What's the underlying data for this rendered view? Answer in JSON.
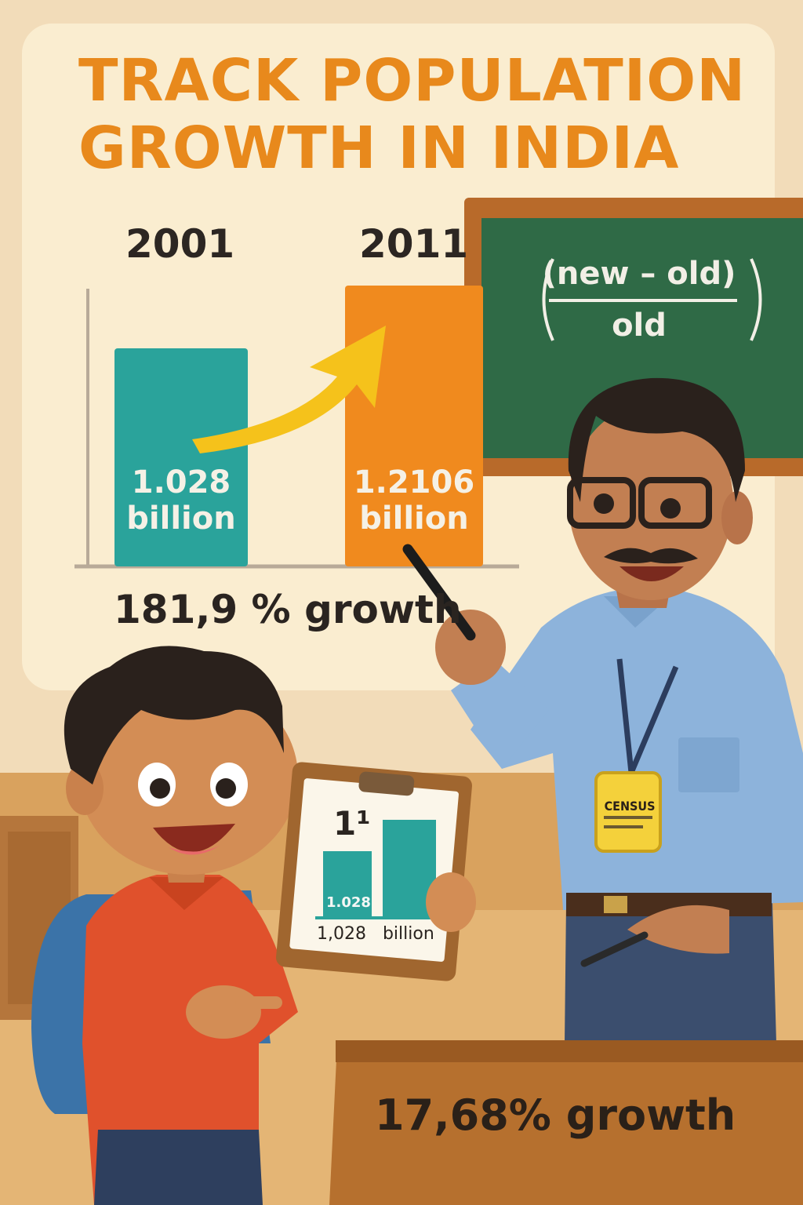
{
  "title": {
    "line1": "TRACK POPULATION",
    "line2": "GROWTH IN INDIA"
  },
  "chart": {
    "bars": [
      {
        "year": "2001",
        "value_line1": "1.028",
        "value_line2": "billion",
        "color": "#2aa39b"
      },
      {
        "year": "2011",
        "value_line1": "1.2106",
        "value_line2": "billion",
        "color": "#f08a1e"
      }
    ],
    "arrow_color": "#f5c21b",
    "growth_label": "181,9 % growth"
  },
  "chalkboard": {
    "numerator": "(new – old)",
    "denominator": "old",
    "board_color": "#2f6a46"
  },
  "teacher": {
    "badge_text": "CENSUS",
    "shirt_color": "#8db3db"
  },
  "clipboard": {
    "number": "1¹",
    "bar_label": "1.028",
    "caption_value": "1,028",
    "caption_unit": "billion"
  },
  "desk": {
    "growth_label": "17,68% growth"
  }
}
